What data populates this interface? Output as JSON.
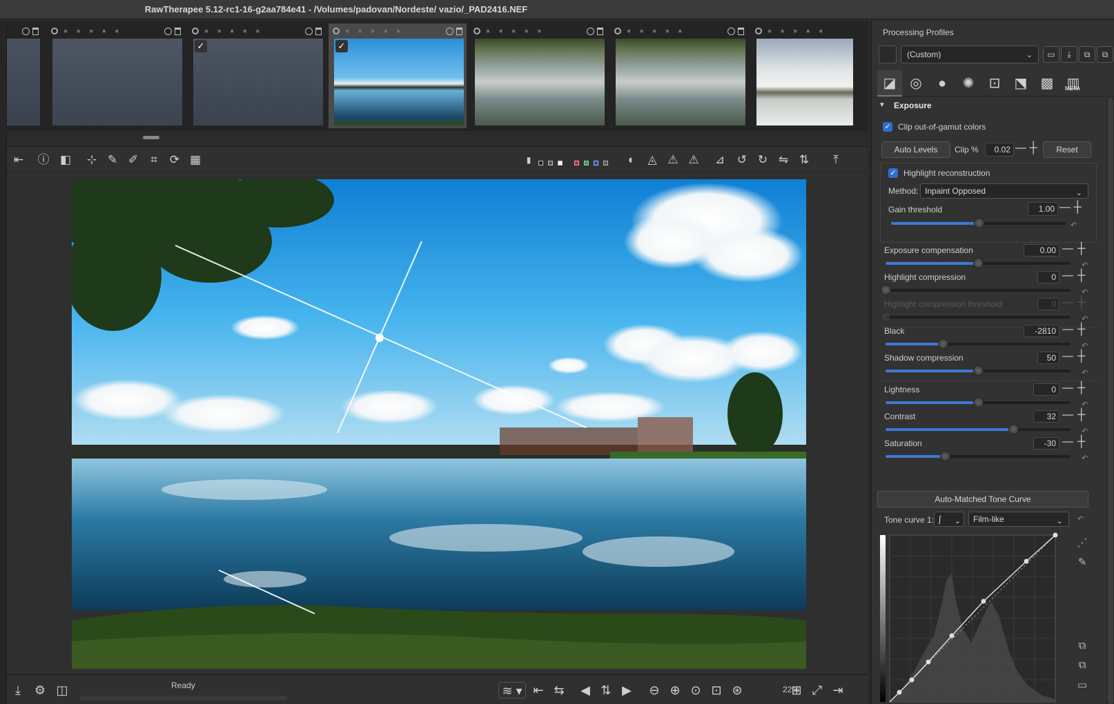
{
  "window": {
    "title": "RawTherapee 5.12-rc1-16-g2aa784e41 - /Volumes/padovan/Nordeste/ vazio/_PAD2416.NEF"
  },
  "filmstrip": {
    "thumbs": [
      {
        "id": "partial",
        "checked": false
      },
      {
        "id": "grey1",
        "checked": false
      },
      {
        "id": "grey2",
        "checked": true
      },
      {
        "id": "selected",
        "checked": true
      },
      {
        "id": "lake1",
        "checked": false
      },
      {
        "id": "lake2",
        "checked": false
      },
      {
        "id": "lake3",
        "checked": false
      }
    ],
    "star_glyph": "★ ★ ★ ★ ★"
  },
  "status": {
    "text": "Ready"
  },
  "zoom": {
    "level": "22%"
  },
  "profiles": {
    "label": "Processing Profiles",
    "selected": "(Custom)"
  },
  "tabs": {
    "meta_label": "META"
  },
  "exposure": {
    "header": "Exposure",
    "clip_label": "Clip out-of-gamut colors",
    "auto_levels": "Auto Levels",
    "clip_pct_label": "Clip %",
    "clip_pct_value": "0.02",
    "reset": "Reset",
    "highlight_recon_label": "Highlight reconstruction",
    "method_label": "Method:",
    "method_value": "Inpaint Opposed",
    "gain_label": "Gain threshold",
    "gain_value": "1.00",
    "gain_pos": 0.5,
    "sliders": [
      {
        "name": "Exposure compensation",
        "value": "0.00",
        "pos": 0.5,
        "disabled": false
      },
      {
        "name": "Highlight compression",
        "value": "0",
        "pos": 0.0,
        "disabled": false
      },
      {
        "name": "Highlight compression threshold",
        "value": "0",
        "pos": 0.0,
        "disabled": true
      },
      {
        "name": "Black",
        "value": "-2810",
        "pos": 0.31,
        "disabled": false
      },
      {
        "name": "Shadow compression",
        "value": "50",
        "pos": 0.5,
        "disabled": false
      },
      {
        "name": "Lightness",
        "value": "0",
        "pos": 0.5,
        "disabled": false
      },
      {
        "name": "Contrast",
        "value": "32",
        "pos": 0.69,
        "disabled": false
      },
      {
        "name": "Saturation",
        "value": "-30",
        "pos": 0.32,
        "disabled": false
      }
    ],
    "auto_tone_curve": "Auto-Matched Tone Curve",
    "tone_curve_label": "Tone curve 1:",
    "tone_curve_mode": "Film-like"
  },
  "colors": {
    "accent": "#3a7bd5",
    "check": "#2e6fd0",
    "bg": "#2b2b2b"
  }
}
